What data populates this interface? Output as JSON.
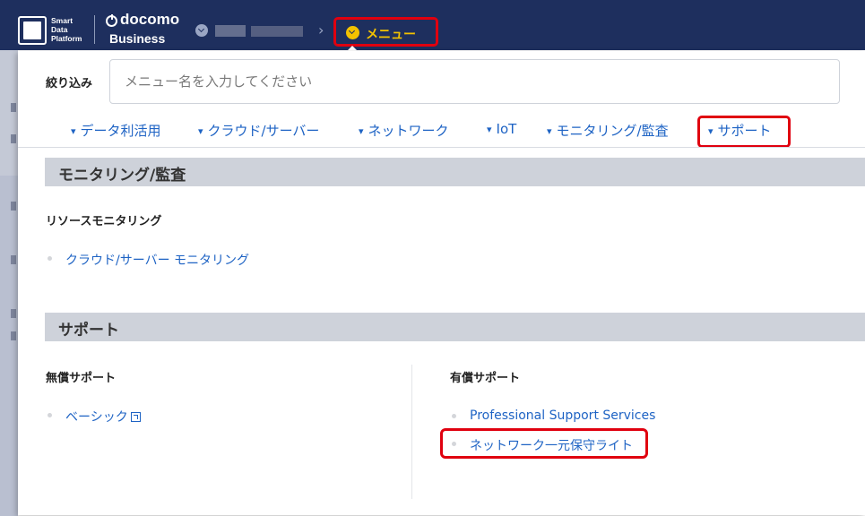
{
  "header": {
    "sdp_lines": [
      "Smart",
      "Data",
      "Platform"
    ],
    "brand_top": "docomo",
    "brand_bottom": "Business",
    "crumb_current": "メニュー"
  },
  "filter": {
    "label": "絞り込み",
    "placeholder": "メニュー名を入力してください"
  },
  "tabs": [
    {
      "label": "データ利活用"
    },
    {
      "label": "クラウド/サーバー"
    },
    {
      "label": "ネットワーク"
    },
    {
      "label": "IoT"
    },
    {
      "label": "モニタリング/監査"
    },
    {
      "label": "サポート"
    }
  ],
  "sections": {
    "monitoring": {
      "title": "モニタリング/監査",
      "subhead": "リソースモニタリング",
      "items": [
        "クラウド/サーバー モニタリング"
      ]
    },
    "support": {
      "title": "サポート",
      "free": {
        "subhead": "無償サポート",
        "items": [
          "ベーシック"
        ]
      },
      "paid": {
        "subhead": "有償サポート",
        "items": [
          "Professional Support Services",
          "ネットワーク一元保守ライト"
        ]
      }
    }
  },
  "colors": {
    "navbar": "#1e2f5e",
    "accent_yellow": "#f3c200",
    "link_blue": "#1e63c4",
    "highlight_red": "#e0000f",
    "section_bar": "#ced2da"
  },
  "icons": {
    "tab_arrow": "↓-chevron",
    "crumb_toggle": "chevron-down-circle",
    "external_link": "external-window"
  }
}
